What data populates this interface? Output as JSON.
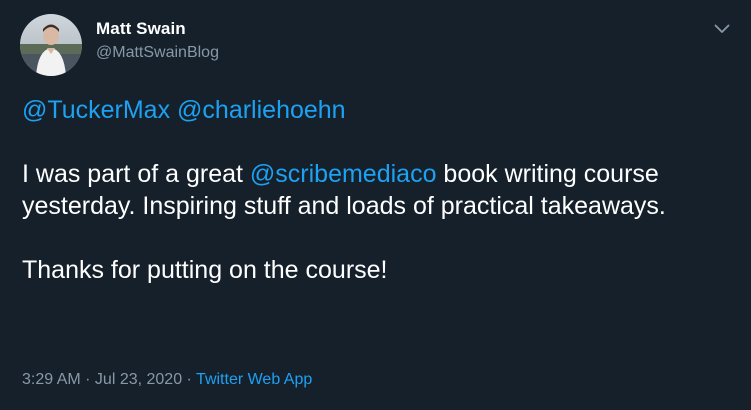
{
  "author": {
    "display_name": "Matt Swain",
    "handle": "@MattSwainBlog"
  },
  "tweet": {
    "mention_1": "@TuckerMax",
    "mention_2": "@charliehoehn",
    "line2_prefix": "I was part of a great ",
    "mention_3": "@scribemediaco",
    "line2_suffix": " book writing course yesterday. Inspiring stuff and loads of practical takeaways.",
    "line3": "Thanks for putting on the course!"
  },
  "meta": {
    "timestamp": "3:29 AM · Jul 23, 2020",
    "separator": " · ",
    "source": "Twitter Web App"
  },
  "icons": {
    "caret": "chevron-down-icon"
  },
  "colors": {
    "background": "#15202b",
    "accent": "#1da1f2",
    "secondary_text": "#8899a6"
  }
}
